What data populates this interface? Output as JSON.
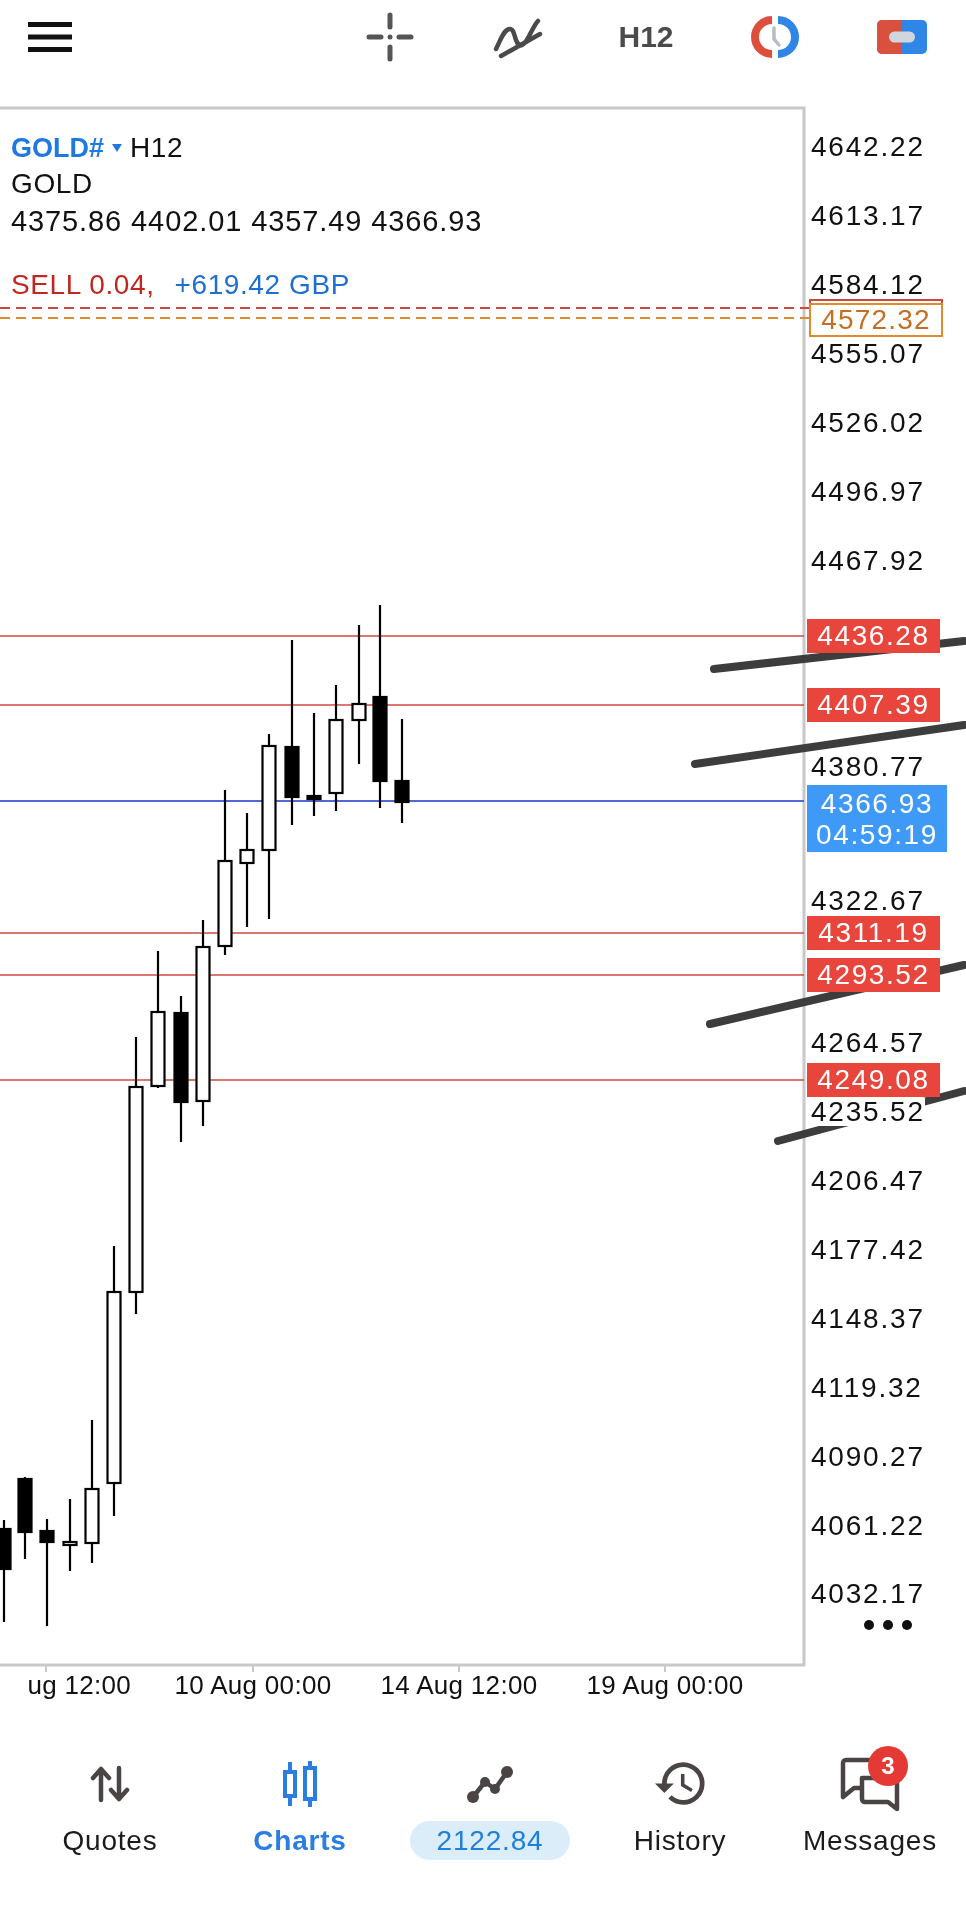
{
  "toolbar": {
    "timeframe": "H12"
  },
  "chart": {
    "symbol": "GOLD#",
    "period": "H12",
    "description": "GOLD",
    "ohlc": "4375.86 4402.01 4357.49 4366.93",
    "position": {
      "order": "SELL 0.04,",
      "profit": "+619.42 GBP",
      "price": "4572.32"
    },
    "price_axis": [
      "4642.22",
      "4613.17",
      "4584.12",
      "4555.07",
      "4526.02",
      "4496.97",
      "4467.92",
      "4380.77",
      "4322.67",
      "4264.57",
      "4235.52",
      "4206.47",
      "4177.42",
      "4148.37",
      "4119.32",
      "4090.27",
      "4061.22",
      "4032.17"
    ],
    "level_lines": [
      {
        "price": "4436.28"
      },
      {
        "price": "4407.39"
      },
      {
        "price": "4311.19"
      },
      {
        "price": "4293.52"
      },
      {
        "price": "4249.08"
      }
    ],
    "bid": {
      "price": "4366.93",
      "countdown": "04:59:19"
    },
    "time_axis": [
      "ug 12:00",
      "10 Aug 00:00",
      "14 Aug 12:00",
      "19 Aug 00:00"
    ]
  },
  "bottom_nav": [
    {
      "label": "Quotes",
      "kind": "tab",
      "selected": false
    },
    {
      "label": "Charts",
      "kind": "tab",
      "selected": true
    },
    {
      "label": "2122.84",
      "kind": "balance",
      "selected": false
    },
    {
      "label": "History",
      "kind": "tab",
      "selected": false
    },
    {
      "label": "Messages",
      "kind": "tab",
      "selected": false,
      "badge": "3"
    }
  ]
}
